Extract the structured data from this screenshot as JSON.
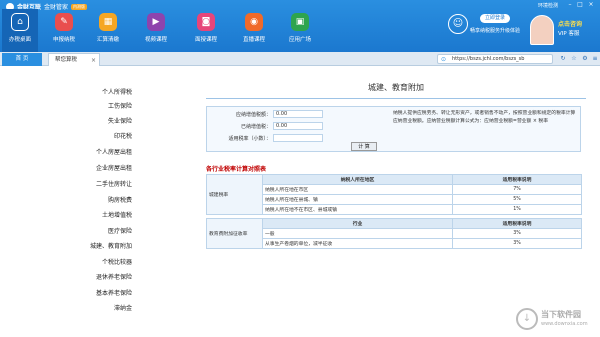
{
  "app": {
    "brand": "金财互联",
    "brand_sub": "金财管家",
    "brand_badge": "内测版",
    "window_title": "环境检测"
  },
  "nav": [
    {
      "label": "办税桌面",
      "icon": "home-icon",
      "color": "#1565b6"
    },
    {
      "label": "申报纳税",
      "icon": "tax-declare-icon",
      "color": "#e94e4e"
    },
    {
      "label": "汇算清缴",
      "icon": "calculator-icon",
      "color": "#f5a623"
    },
    {
      "label": "视频课程",
      "icon": "video-course-icon",
      "color": "#8e44ad"
    },
    {
      "label": "面授课程",
      "icon": "camera-icon",
      "color": "#e6457a"
    },
    {
      "label": "直播课程",
      "icon": "live-icon",
      "color": "#f06a2a"
    },
    {
      "label": "应用广场",
      "icon": "apps-icon",
      "color": "#2ea44f"
    }
  ],
  "user": {
    "login_label": "立即登录",
    "login_tip": "畅享纳税服务升级体验"
  },
  "consult": {
    "title": "点击咨询",
    "vip": "VIP 客服"
  },
  "tabs": [
    {
      "label": "首 页"
    },
    {
      "label": "帮您算税"
    }
  ],
  "address": "https://bszs.jchl.com/bszs_sb",
  "sidebar": {
    "items": [
      {
        "label": "个人所得税"
      },
      {
        "label": "工伤保险"
      },
      {
        "label": "失业保险"
      },
      {
        "label": "印花税"
      },
      {
        "label": "个人房屋出租"
      },
      {
        "label": "企业房屋出租"
      },
      {
        "label": "二手住房转让"
      },
      {
        "label": "购房税费"
      },
      {
        "label": "土地增值税"
      },
      {
        "label": "医疗保险"
      },
      {
        "label": "城建、教育附加"
      },
      {
        "label": "个税比较器"
      },
      {
        "label": "退休养老保险"
      },
      {
        "label": "基本养老保险"
      },
      {
        "label": "滞纳金"
      }
    ]
  },
  "main": {
    "title": "城建、教育附加",
    "form": {
      "vat_label": "应纳增值税额：",
      "vat_value": "0.00",
      "consumption_label": "已纳增值税：",
      "consumption_value": "0.00",
      "rate_label": "适用税率（小数）：",
      "rate_value": "",
      "note": "纳税人提供应税劳务、转让无形资产，或者销售不动产，按照营业额和规定的税率计算应纳营业税额。应纳营业税额计算公式为：应纳营业税额=营业额 × 税率",
      "calc_button": "计 算"
    },
    "rate_table_title": "各行业税率计算对照表",
    "table1": {
      "group": "城建税率",
      "head_area": "纳税人所在地区",
      "head_rate": "适用税率说明",
      "rows": [
        {
          "area": "纳税人所在地在市区",
          "rate": "7%"
        },
        {
          "area": "纳税人所在地在县城、镇",
          "rate": "5%"
        },
        {
          "area": "纳税人所在地不在市区、县城或镇",
          "rate": "1%"
        }
      ]
    },
    "table2": {
      "group": "教育费附加征收率",
      "head_industry": "行业",
      "head_rate": "适用税率说明",
      "rows": [
        {
          "industry": "一般",
          "rate": "3%"
        },
        {
          "industry": "从事生产卷烟的单位，减半征收",
          "rate": "3%"
        }
      ]
    }
  },
  "watermark": {
    "text": "当下软件园",
    "sub": "www.downxia.com"
  }
}
